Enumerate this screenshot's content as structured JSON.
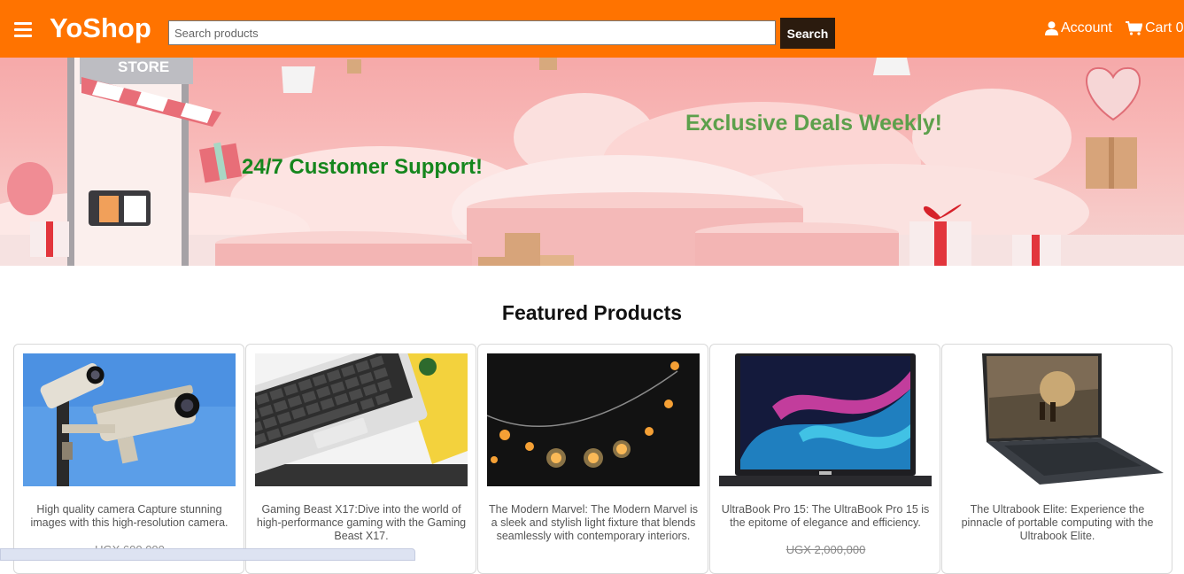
{
  "header": {
    "brand": "YoShop",
    "search_placeholder": "Search products",
    "search_button": "Search",
    "account_label": "Account",
    "cart_label": "Cart 0"
  },
  "banner": {
    "headline_1": "24/7 Customer Support!",
    "headline_2": "Exclusive Deals Weekly!",
    "store_sign": "STORE"
  },
  "featured": {
    "title": "Featured Products",
    "products": [
      {
        "description": "High quality camera Capture stunning images with this high-resolution camera.",
        "price": "UGX 600,000"
      },
      {
        "description": "Gaming Beast X17:Dive into the world of high-performance gaming with the Gaming Beast X17.",
        "price": ""
      },
      {
        "description": "The Modern Marvel: The Modern Marvel is a sleek and stylish light fixture that blends seamlessly with contemporary interiors.",
        "price": ""
      },
      {
        "description": "UltraBook Pro 15: The UltraBook Pro 15 is the epitome of elegance and efficiency.",
        "price": "UGX 2,000,000"
      },
      {
        "description": "The Ultrabook Elite: Experience the pinnacle of portable computing with the Ultrabook Elite.",
        "price": ""
      }
    ]
  },
  "colors": {
    "header_bg": "#ff7300",
    "search_button_bg": "#2b1b0e",
    "headline_1": "#15861d",
    "headline_2": "#5da04c"
  },
  "icons": [
    "menu-icon",
    "user-icon",
    "cart-icon"
  ]
}
